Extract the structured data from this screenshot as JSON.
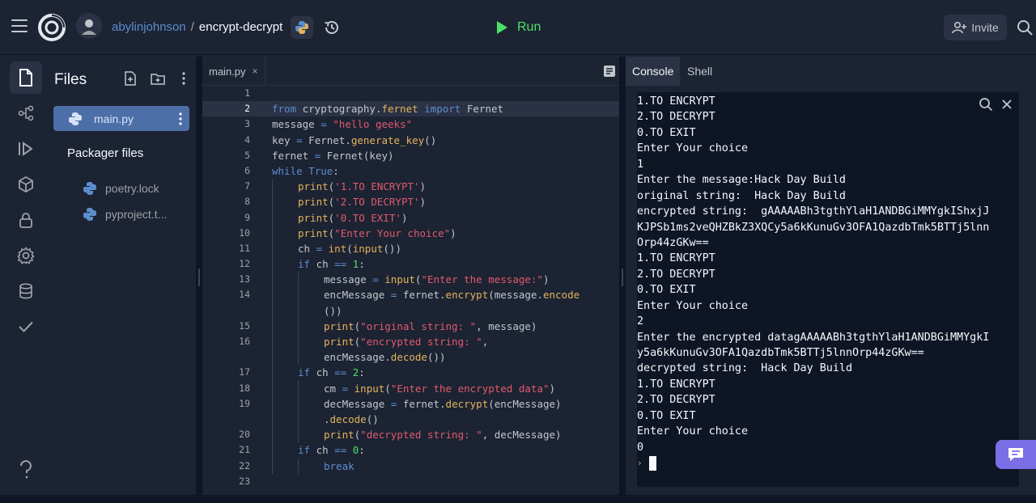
{
  "header": {
    "username": "abylinjohnson",
    "separator": "/",
    "repl_name": "encrypt-decrypt",
    "run_label": "Run",
    "invite_label": "Invite"
  },
  "colors": {
    "background": "#1c2333",
    "panel_dark": "#0e1525",
    "accent_blue": "#5b8ecf",
    "run_green": "#4ce068",
    "selected_file": "#4d6fa8",
    "chat_purple": "#7b6ee6"
  },
  "rail": {
    "icons": [
      "files-icon",
      "git-icon",
      "debugger-icon",
      "packages-icon",
      "secrets-lock-icon",
      "settings-gear-icon",
      "database-icon",
      "unit-tests-check-icon",
      "help-icon"
    ]
  },
  "files": {
    "title": "Files",
    "selected_file": "main.py",
    "packager_title": "Packager files",
    "packager_items": [
      "poetry.lock",
      "pyproject.t..."
    ]
  },
  "editor": {
    "tab_label": "main.py",
    "tab_close": "×",
    "lines": [
      {
        "n": "1",
        "code": ""
      },
      {
        "n": "2",
        "code": "from cryptography.fernet import Fernet"
      },
      {
        "n": "3",
        "code": "message = \"hello geeks\""
      },
      {
        "n": "4",
        "code": "key = Fernet.generate_key()"
      },
      {
        "n": "5",
        "code": "fernet = Fernet(key)"
      },
      {
        "n": "6",
        "code": "while True:"
      },
      {
        "n": "7",
        "code": "print('1.TO ENCRYPT')"
      },
      {
        "n": "8",
        "code": "print('2.TO DECRYPT')"
      },
      {
        "n": "9",
        "code": "print('0.TO EXIT')"
      },
      {
        "n": "10",
        "code": "print(\"Enter Your choice\")"
      },
      {
        "n": "11",
        "code": "ch = int(input())"
      },
      {
        "n": "12",
        "code": "if ch == 1:"
      },
      {
        "n": "13",
        "code": "message = input(\"Enter the message:\")"
      },
      {
        "n": "14",
        "code": "encMessage = fernet.encrypt(message.encode"
      },
      {
        "n": "",
        "code": "())"
      },
      {
        "n": "15",
        "code": "print(\"original string: \", message)"
      },
      {
        "n": "16",
        "code": "print(\"encrypted string: \","
      },
      {
        "n": "",
        "code": "encMessage.decode())"
      },
      {
        "n": "17",
        "code": "if ch == 2:"
      },
      {
        "n": "18",
        "code": "cm = input(\"Enter the encrypted data\")"
      },
      {
        "n": "19",
        "code": "decMessage = fernet.decrypt(encMessage)"
      },
      {
        "n": "",
        "code": ".decode()"
      },
      {
        "n": "20",
        "code": "print(\"decrypted string: \", decMessage)"
      },
      {
        "n": "21",
        "code": "if ch == 0:"
      },
      {
        "n": "22",
        "code": "break"
      },
      {
        "n": "23",
        "code": ""
      }
    ]
  },
  "console": {
    "tab_console": "Console",
    "tab_shell": "Shell",
    "output": [
      "1.TO ENCRYPT",
      "2.TO DECRYPT",
      "0.TO EXIT",
      "Enter Your choice",
      "1",
      "Enter the message:Hack Day Build",
      "original string:  Hack Day Build",
      "encrypted string:  gAAAAABh3tgthYlaH1ANDBGiMMYgkIShxjJ",
      "KJPSb1ms2veQHZBkZ3XQCy5a6kKunuGv3OFA1QazdbTmk5BTTj5lnn",
      "Orp44zGKw==",
      "1.TO ENCRYPT",
      "2.TO DECRYPT",
      "0.TO EXIT",
      "Enter Your choice",
      "2",
      "Enter the encrypted datagAAAAABh3tgthYlaH1ANDBGiMMYgkI",
      "y5a6kKunuGv3OFA1QazdbTmk5BTTj5lnnOrp44zGKw==",
      "decrypted string:  Hack Day Build",
      "1.TO ENCRYPT",
      "2.TO DECRYPT",
      "0.TO EXIT",
      "Enter Your choice",
      "0"
    ],
    "prompt": "›"
  }
}
